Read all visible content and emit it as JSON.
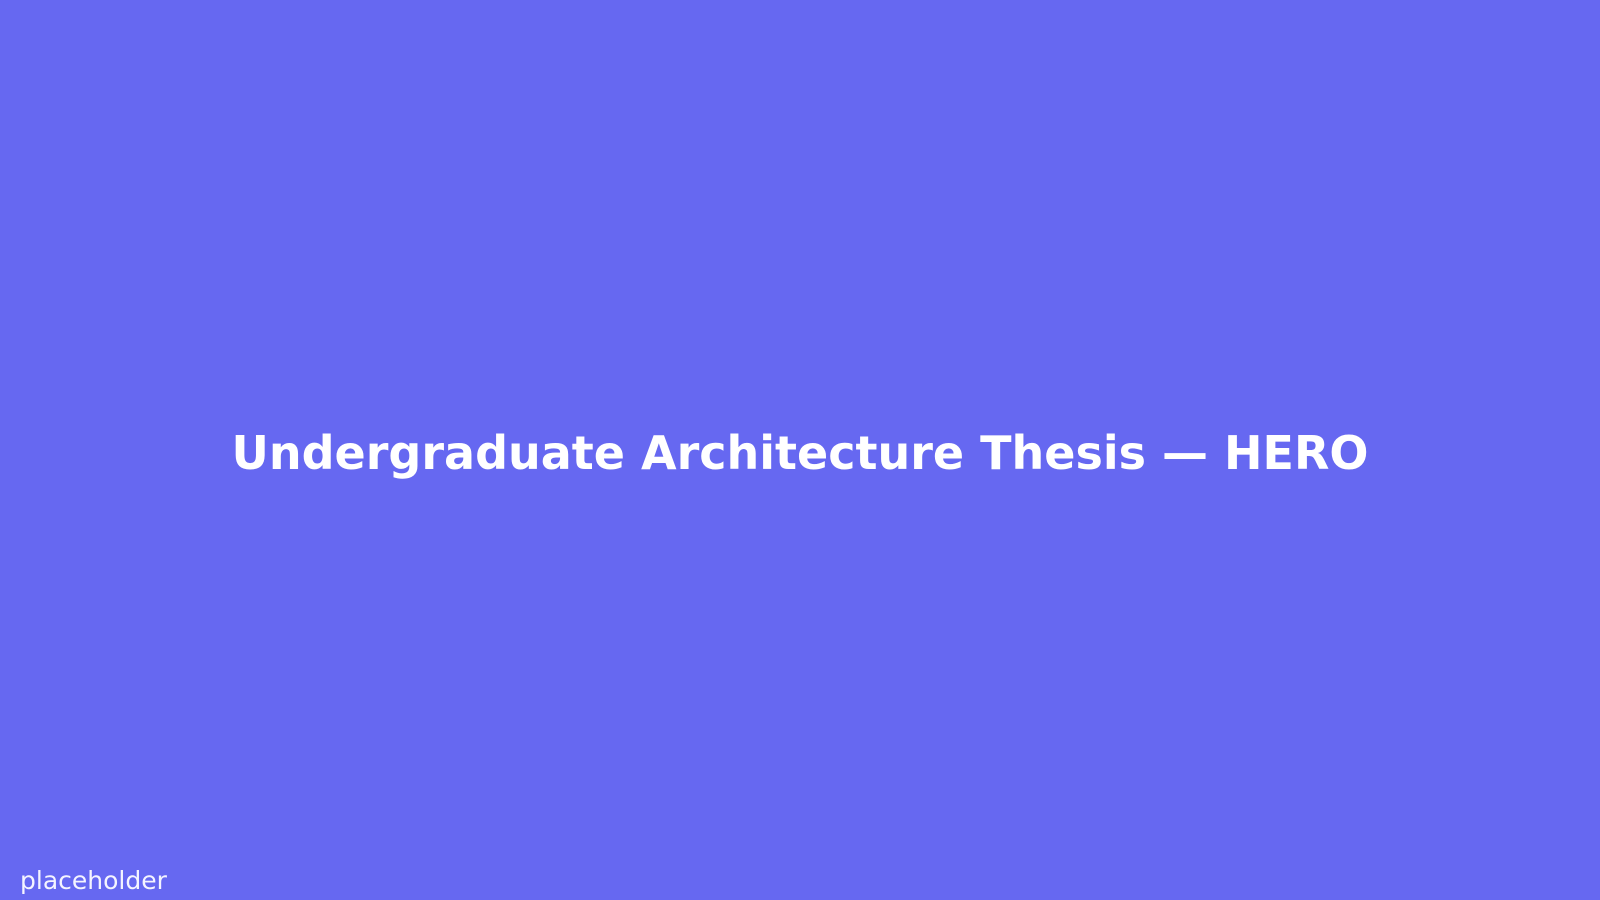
{
  "hero": {
    "title": "Undergraduate Architecture Thesis — HERO",
    "caption": "placeholder",
    "background_color": "#6668f1",
    "text_color": "#ffffff"
  }
}
